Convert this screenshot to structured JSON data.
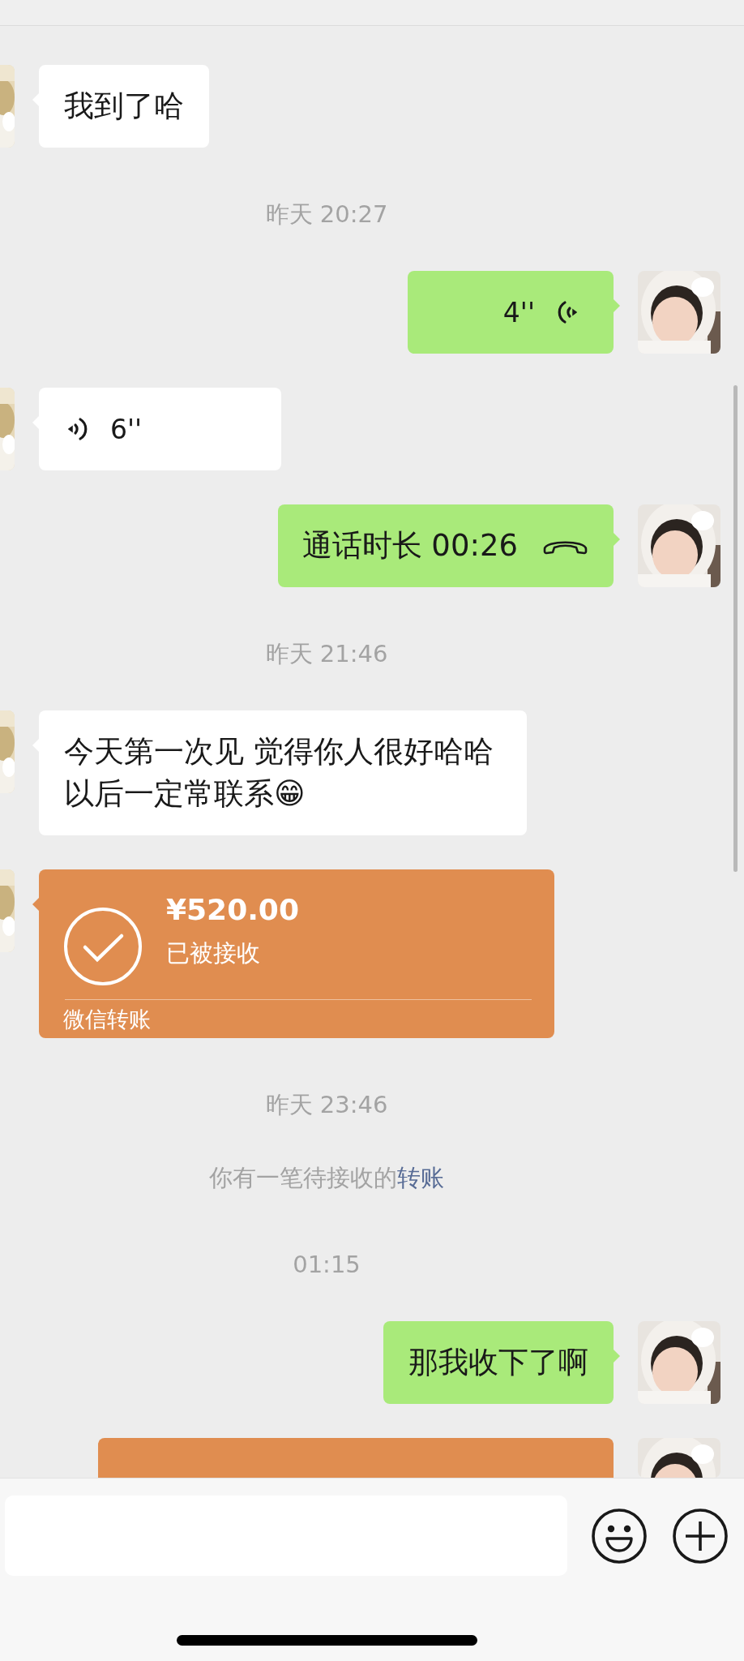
{
  "messages": [
    {
      "kind": "text",
      "outgoing": false,
      "text": "我到了哈"
    },
    {
      "kind": "time",
      "text": "昨天 20:27"
    },
    {
      "kind": "voice",
      "outgoing": true,
      "text": "4''"
    },
    {
      "kind": "voice",
      "outgoing": false,
      "text": "6''"
    },
    {
      "kind": "call",
      "outgoing": true,
      "text": "通话时长 00:26"
    },
    {
      "kind": "time",
      "text": "昨天 21:46"
    },
    {
      "kind": "text",
      "outgoing": false,
      "text": "今天第一次见 觉得你人很好哈哈以后一定常联系😁"
    },
    {
      "kind": "transfer",
      "outgoing": false,
      "amount": "¥520.00",
      "status": "已被接收",
      "footer": "微信转账"
    },
    {
      "kind": "time",
      "text": "昨天 23:46"
    },
    {
      "kind": "system",
      "text": "你有一笔待接收的",
      "link": "转账"
    },
    {
      "kind": "time",
      "text": "01:15"
    },
    {
      "kind": "text",
      "outgoing": true,
      "text": "那我收下了啊"
    },
    {
      "kind": "transfer",
      "outgoing": true
    }
  ]
}
